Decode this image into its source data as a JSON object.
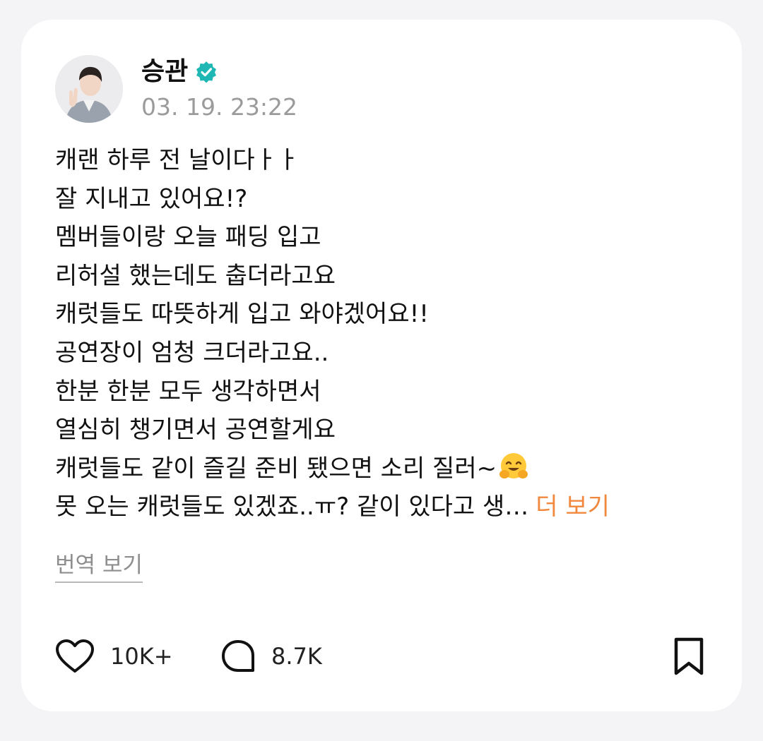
{
  "post": {
    "author": "승관",
    "timestamp": "03. 19. 23:22",
    "lines": [
      "캐랜 하루 전 날이다ㅏㅏ",
      "잘 지내고 있어요!?",
      "멤버들이랑 오늘 패딩 입고",
      "리허설 했는데도 춥더라고요",
      "캐럿들도 따뜻하게 입고 와야겠어요!!",
      "공연장이 엄청 크더라고요..",
      "한분 한분 모두 생각하면서",
      "열심히 챙기면서 공연할게요",
      "캐럿들도 같이 즐길 준비 됐으면 소리 질러~",
      "못 오는 캐럿들도 있겠죠..ㅠ?  같이 있다고 생…"
    ],
    "more_label": "더 보기",
    "translate_label": "번역 보기"
  },
  "actions": {
    "likes": "10K+",
    "comments": "8.7K"
  },
  "icons": {
    "verified": "verified-badge-icon",
    "emoji": "hugging-face-emoji",
    "like": "heart-icon",
    "comment": "comment-bubble-icon",
    "bookmark": "bookmark-icon"
  },
  "colors": {
    "verified": "#1fb7b4",
    "more_link": "#f0883e",
    "timestamp": "#9b9b9b"
  }
}
